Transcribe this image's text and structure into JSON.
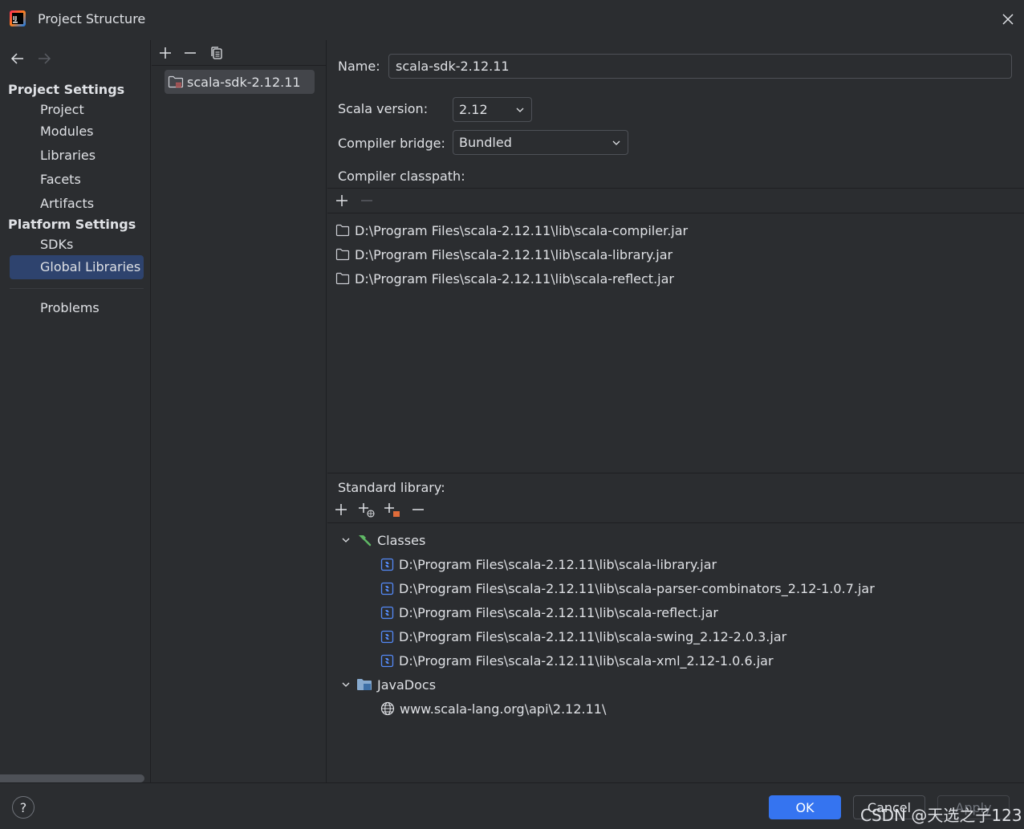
{
  "window": {
    "title": "Project Structure"
  },
  "sidebar": {
    "project_settings_title": "Project Settings",
    "platform_settings_title": "Platform Settings",
    "items": [
      {
        "label": "Project"
      },
      {
        "label": "Modules"
      },
      {
        "label": "Libraries"
      },
      {
        "label": "Facets"
      },
      {
        "label": "Artifacts"
      },
      {
        "label": "SDKs"
      },
      {
        "label": "Global Libraries",
        "selected": true
      },
      {
        "label": "Problems"
      }
    ]
  },
  "library_list": {
    "items": [
      {
        "label": "scala-sdk-2.12.11",
        "selected": true
      }
    ]
  },
  "details": {
    "name_label": "Name:",
    "name_value": "scala-sdk-2.12.11",
    "scala_version_label": "Scala version:",
    "scala_version_value": "2.12",
    "compiler_bridge_label": "Compiler bridge:",
    "compiler_bridge_value": "Bundled",
    "compiler_classpath_label": "Compiler classpath:",
    "compiler_classpath": [
      "D:\\Program Files\\scala-2.12.11\\lib\\scala-compiler.jar",
      "D:\\Program Files\\scala-2.12.11\\lib\\scala-library.jar",
      "D:\\Program Files\\scala-2.12.11\\lib\\scala-reflect.jar"
    ],
    "standard_library_label": "Standard library:",
    "classes_label": "Classes",
    "classes": [
      "D:\\Program Files\\scala-2.12.11\\lib\\scala-library.jar",
      "D:\\Program Files\\scala-2.12.11\\lib\\scala-parser-combinators_2.12-1.0.7.jar",
      "D:\\Program Files\\scala-2.12.11\\lib\\scala-reflect.jar",
      "D:\\Program Files\\scala-2.12.11\\lib\\scala-swing_2.12-2.0.3.jar",
      "D:\\Program Files\\scala-2.12.11\\lib\\scala-xml_2.12-1.0.6.jar"
    ],
    "javadocs_label": "JavaDocs",
    "javadocs": [
      "www.scala-lang.org\\api\\2.12.11\\"
    ]
  },
  "footer": {
    "help_label": "?",
    "ok_label": "OK",
    "cancel_label": "Cancel",
    "apply_label": "Apply",
    "watermark": "CSDN @天选之子123"
  },
  "colors": {
    "background": "#2b2d30",
    "selection": "#2e436e",
    "primary_button": "#3574f0",
    "text": "#dfe1e5"
  },
  "icons": {
    "app": "intellij-logo-icon",
    "close": "close-icon",
    "back": "arrow-left-icon",
    "forward": "arrow-right-icon",
    "add": "plus-icon",
    "remove": "minus-icon",
    "copy": "copy-icon",
    "folder": "folder-icon",
    "jar": "jar-icon",
    "classes": "hammer-icon",
    "javadocs": "docs-folder-icon",
    "web": "globe-icon",
    "chevron": "chevron-down-icon"
  }
}
